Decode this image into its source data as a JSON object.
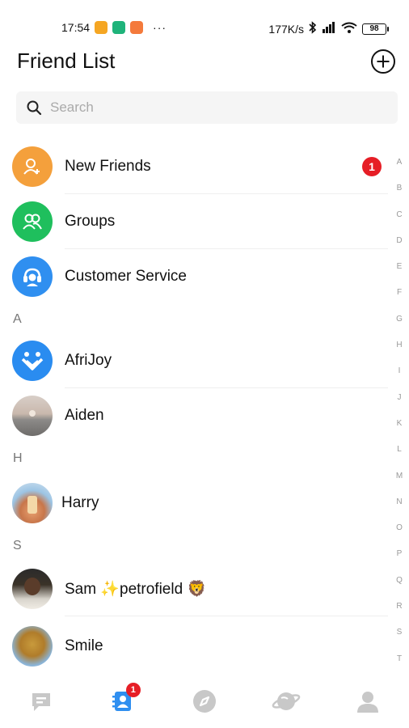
{
  "status_bar": {
    "time": "17:54",
    "dots": "···",
    "network_speed": "177K/s",
    "battery": "98"
  },
  "header": {
    "title": "Friend List"
  },
  "search": {
    "placeholder": "Search"
  },
  "special_items": [
    {
      "label": "New Friends",
      "badge": "1",
      "icon": "add-user-icon",
      "color": "#f4a03c"
    },
    {
      "label": "Groups",
      "icon": "group-icon",
      "color": "#1fbf5d"
    },
    {
      "label": "Customer Service",
      "icon": "headset-icon",
      "color": "#2f8ff0"
    }
  ],
  "sections": [
    {
      "letter": "A",
      "contacts": [
        "AfriJoy",
        "Aiden"
      ]
    },
    {
      "letter": "H",
      "contacts": [
        "Harry"
      ]
    },
    {
      "letter": "S",
      "contacts": [
        "Sam ✨petrofield 🦁",
        "Smile"
      ]
    }
  ],
  "alphabet_index": [
    "A",
    "B",
    "C",
    "D",
    "E",
    "F",
    "G",
    "H",
    "I",
    "J",
    "K",
    "L",
    "M",
    "N",
    "O",
    "P",
    "Q",
    "R",
    "S",
    "T"
  ],
  "bottom_nav": {
    "items": [
      {
        "name": "chats",
        "icon": "chat-icon"
      },
      {
        "name": "contacts",
        "icon": "contacts-icon",
        "badge": "1",
        "active": true
      },
      {
        "name": "discover",
        "icon": "compass-icon"
      },
      {
        "name": "explore",
        "icon": "planet-icon"
      },
      {
        "name": "me",
        "icon": "profile-icon"
      }
    ],
    "accent_color": "#2f8ff0",
    "inactive_color": "#c8c8c8"
  }
}
